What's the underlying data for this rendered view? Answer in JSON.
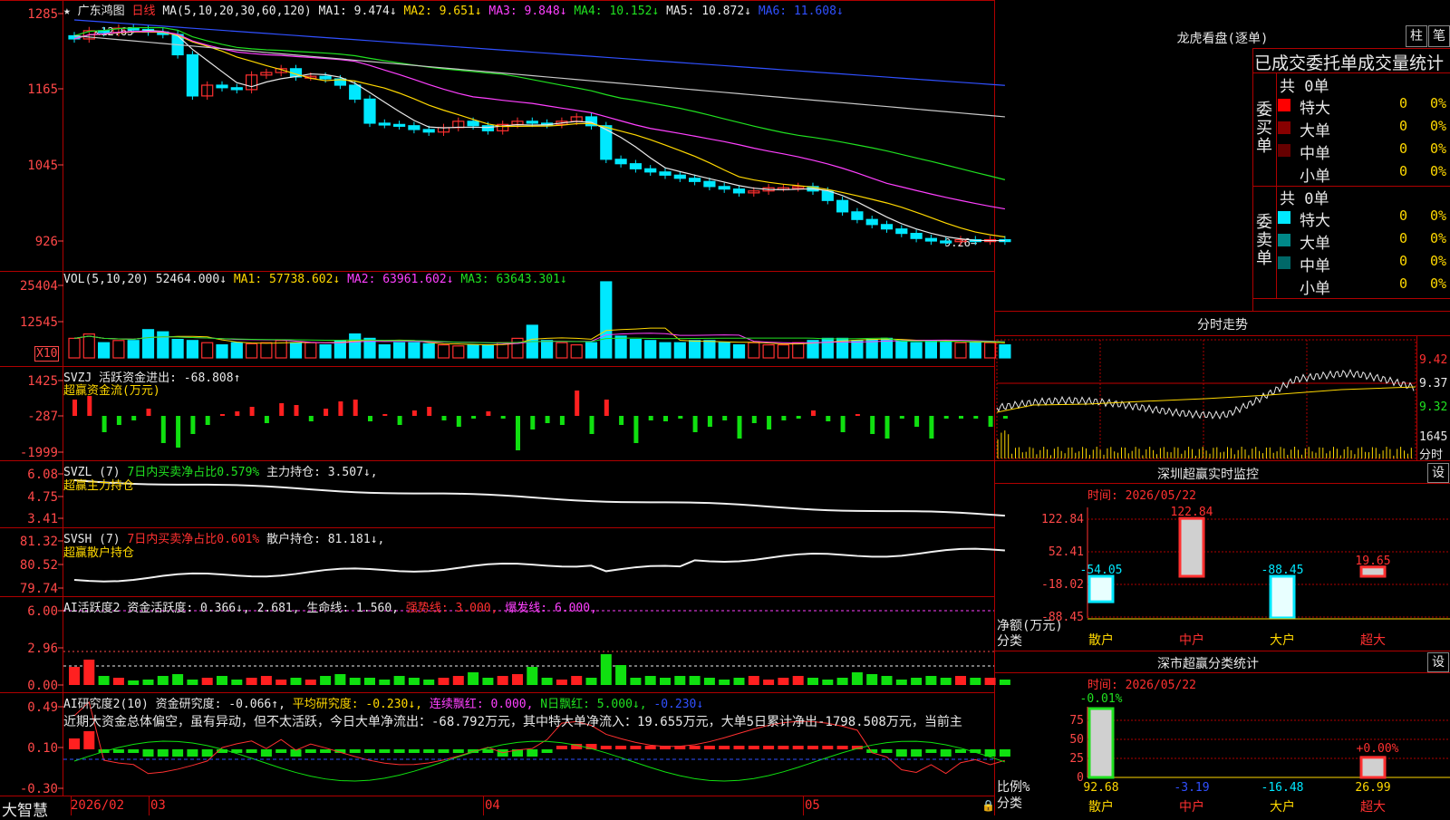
{
  "main": {
    "star": "★",
    "stock_name": "广东鸿图",
    "period": "日线",
    "ma_label": "MA(5,10,20,30,60,120)",
    "ma1": "MA1: 9.474↓",
    "ma2": "MA2: 9.651↓",
    "ma3": "MA3: 9.848↓",
    "ma4": "MA4: 10.152↓",
    "ma5": "MA5: 10.872↓",
    "ma6": "MA6: 11.608↓",
    "yticks": [
      "1285",
      "1165",
      "1045",
      "926"
    ],
    "high_mark": "12.65",
    "low_mark": "9.26→"
  },
  "vol": {
    "label": "VOL(5,10,20)",
    "value": "52464.000↓",
    "ma1": "MA1: 57738.602↓",
    "ma2": "MA2: 63961.602↓",
    "ma3": "MA3: 63643.301↓",
    "yticks": [
      "25404",
      "12545"
    ],
    "unit": "X10"
  },
  "svzj": {
    "label": "SVZJ",
    "text": "活跃资金进出: -68.808↑",
    "name": "超赢资金流(万元)",
    "yticks": [
      "1425",
      "-287",
      "-1999"
    ]
  },
  "svzl": {
    "label": "SVZL (7)",
    "text1": "7日内买卖净占比0.579%",
    "text2": "主力持仓: 3.507↓,",
    "name": "超赢主力持仓",
    "yticks": [
      "6.08",
      "4.75",
      "3.41"
    ]
  },
  "svsh": {
    "label": "SVSH (7)",
    "text1": "7日内买卖净占比0.601%",
    "text2": "散户持仓: 81.181↓,",
    "name": "超赢散户持仓",
    "yticks": [
      "81.32",
      "80.52",
      "79.74"
    ]
  },
  "ai1": {
    "label": "AI活跃度2",
    "t1": "资金活跃度: 0.366↓,",
    "t2": "2.681,",
    "t3": "生命线: 1.560,",
    "t4": "强势线: 3.000,",
    "t5": "爆发线: 6.000,",
    "yticks": [
      "6.00",
      "2.96",
      "0.00"
    ]
  },
  "ai2": {
    "label": "AI研究度2(10)",
    "t1": "资金研究度: -0.066↑,",
    "t2": "平均研究度: -0.230↓,",
    "t3": "连续飘红: 0.000,",
    "t4": "N日飘红: 5.000↓,",
    "t5": "-0.230↓",
    "comment": "近期大资金总体偏空，虽有异动，但不太活跃，今日大单净流出：-68.792万元，其中特大单净流入：19.655万元，大单5日累计净出-1798.508万元，当前主",
    "yticks": [
      "0.49",
      "0.10",
      "-0.30"
    ]
  },
  "bottom": {
    "brand": "大智慧",
    "dates": [
      "2026/02",
      "03",
      "04",
      "05"
    ]
  },
  "right": {
    "dragon_title": "龙虎看盘(逐单)",
    "btn_zhu": "柱",
    "btn_bi": "笔",
    "order_header": "已成交委托单成交量统计",
    "buy_label": "委买单",
    "sell_label": "委卖单",
    "buy_total": "共 0单",
    "sell_total": "共 0单",
    "rows": [
      {
        "name": "特大",
        "count": "0",
        "pct": "0%"
      },
      {
        "name": "大单",
        "count": "0",
        "pct": "0%"
      },
      {
        "name": "中单",
        "count": "0",
        "pct": "0%"
      },
      {
        "name": "小单",
        "count": "0",
        "pct": "0%"
      }
    ],
    "buy_colors": [
      "#ff0000",
      "#880000",
      "#660000",
      ""
    ],
    "sell_colors": [
      "#00e8ff",
      "#008888",
      "#006868",
      ""
    ],
    "fs_title": "分时走势",
    "fs_prices": [
      "9.42",
      "9.37",
      "9.32"
    ],
    "fs_vol": "1645",
    "fs_label": "分时",
    "mon_title": "深圳超赢实时监控",
    "btn_set1": "设",
    "mon_date": "时间: 2026/05/22",
    "mon_yticks": [
      "122.84",
      "52.41",
      "-18.02",
      "-88.45"
    ],
    "mon_unit": "净额(万元)",
    "mon_cat": "分类",
    "categories": [
      "散户",
      "中户",
      "大户",
      "超大"
    ],
    "mon_values": [
      -54.05,
      122.84,
      -88.45,
      19.65
    ],
    "mon_value_labels": [
      "-54.05",
      "122.84",
      "-88.45",
      "19.65"
    ],
    "cls_title": "深市超赢分类统计",
    "btn_set2": "设",
    "cls_date": "时间: 2026/05/22",
    "cls_yticks": [
      "75",
      "50",
      "25",
      "0"
    ],
    "cls_unit": "比例%",
    "cls_cat": "分类",
    "cls_values": [
      92.68,
      -3.19,
      -16.48,
      26.99
    ],
    "cls_value_labels": [
      "92.68",
      "-3.19",
      "-16.48",
      "26.99"
    ],
    "cls_top_labels": [
      "-0.01%",
      "+0.00%"
    ]
  },
  "colors": {
    "up": "#ff3030",
    "down": "#00e8ff",
    "ma_white": "#e8e8e8",
    "ma_yellow": "#ffd800",
    "ma_magenta": "#ff40ff",
    "ma_green": "#20e020",
    "ma_grey": "#c8c8c8",
    "ma_blue": "#3050ff"
  },
  "chart_data": {
    "type": "bar",
    "title": "深圳超赢实时监控",
    "categories": [
      "散户",
      "中户",
      "大户",
      "超大"
    ],
    "series": [
      {
        "name": "净额(万元)",
        "values": [
          -54.05,
          122.84,
          -88.45,
          19.65
        ]
      },
      {
        "name": "比例%",
        "values": [
          92.68,
          -3.19,
          -16.48,
          26.99
        ]
      }
    ],
    "ylim": [
      -88.45,
      122.84
    ]
  }
}
